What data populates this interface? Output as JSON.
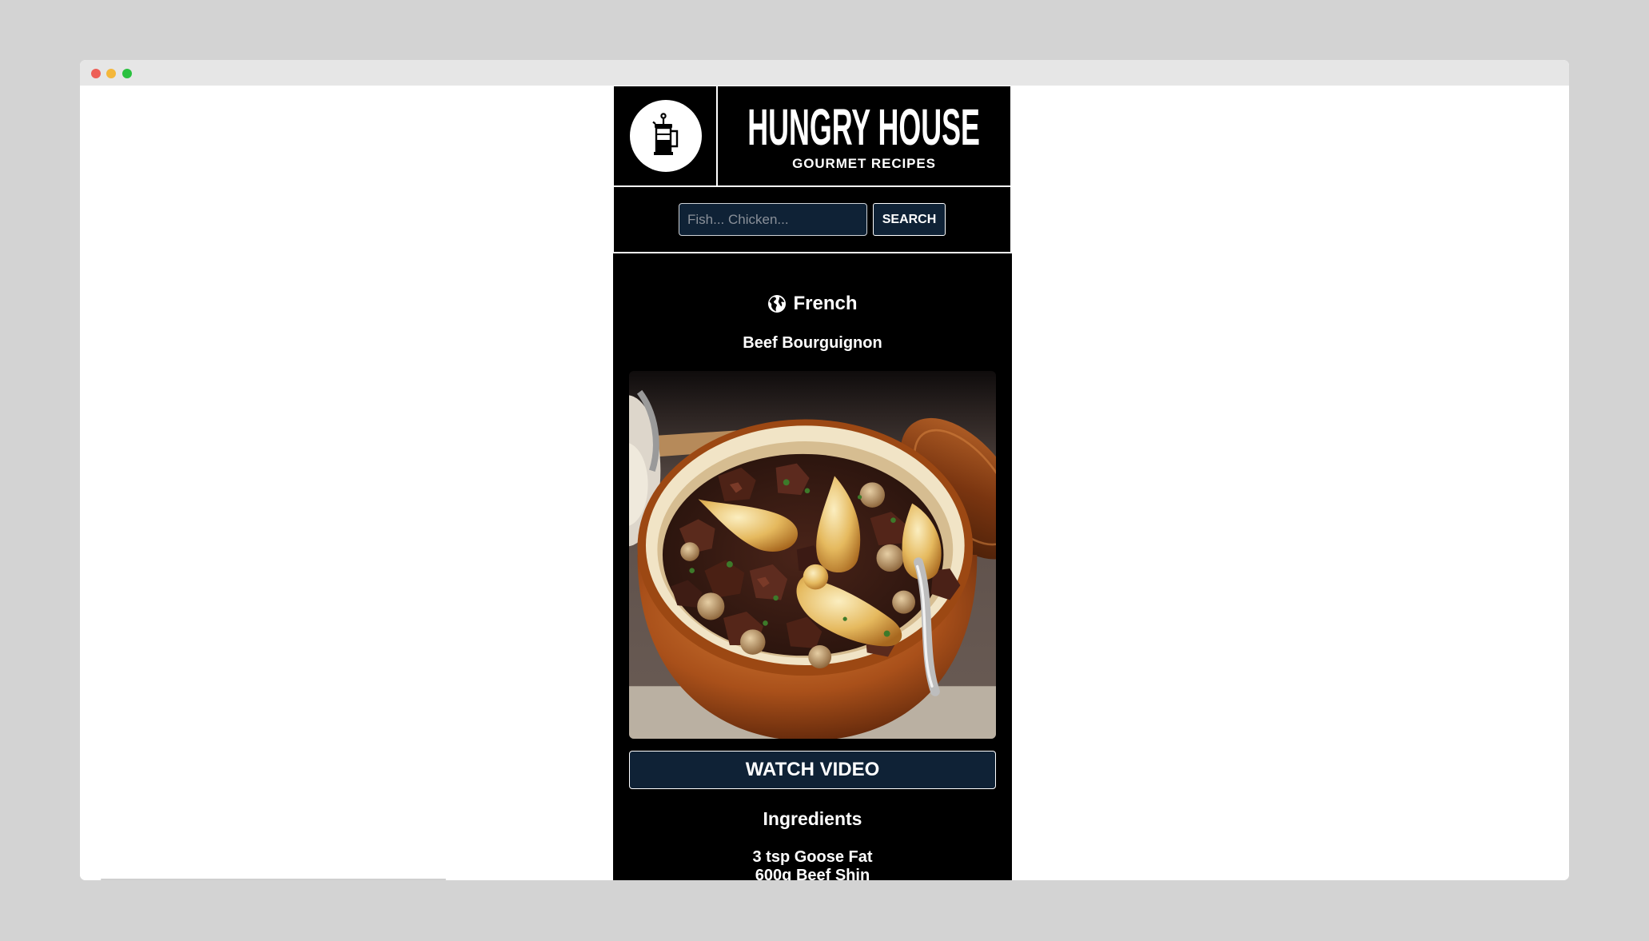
{
  "theme": {
    "page_bg": "#d3d3d3",
    "titlebar_bg": "#e6e6e6",
    "content_bg": "#ffffff",
    "panel_bg": "#000000",
    "accent": "#0f2236",
    "text": "#ffffff",
    "placeholder": "#8a9099",
    "traffic_lights": {
      "close": "#ed5f57",
      "minimize": "#f4b73b",
      "maximize": "#2ac13f"
    }
  },
  "header": {
    "logo_icon": "french-press-icon",
    "brand_title": "HUNGRY HOUSE",
    "brand_subtitle": "GOURMET RECIPES"
  },
  "search": {
    "placeholder": "Fish... Chicken...",
    "button_label": "SEARCH"
  },
  "recipe": {
    "cuisine_icon": "globe-icon",
    "cuisine": "French",
    "title": "Beef Bourguignon",
    "watch_video_label": "WATCH VIDEO",
    "ingredients_heading": "Ingredients",
    "ingredients": [
      "3 tsp Goose Fat",
      "600g Beef Shin"
    ]
  }
}
